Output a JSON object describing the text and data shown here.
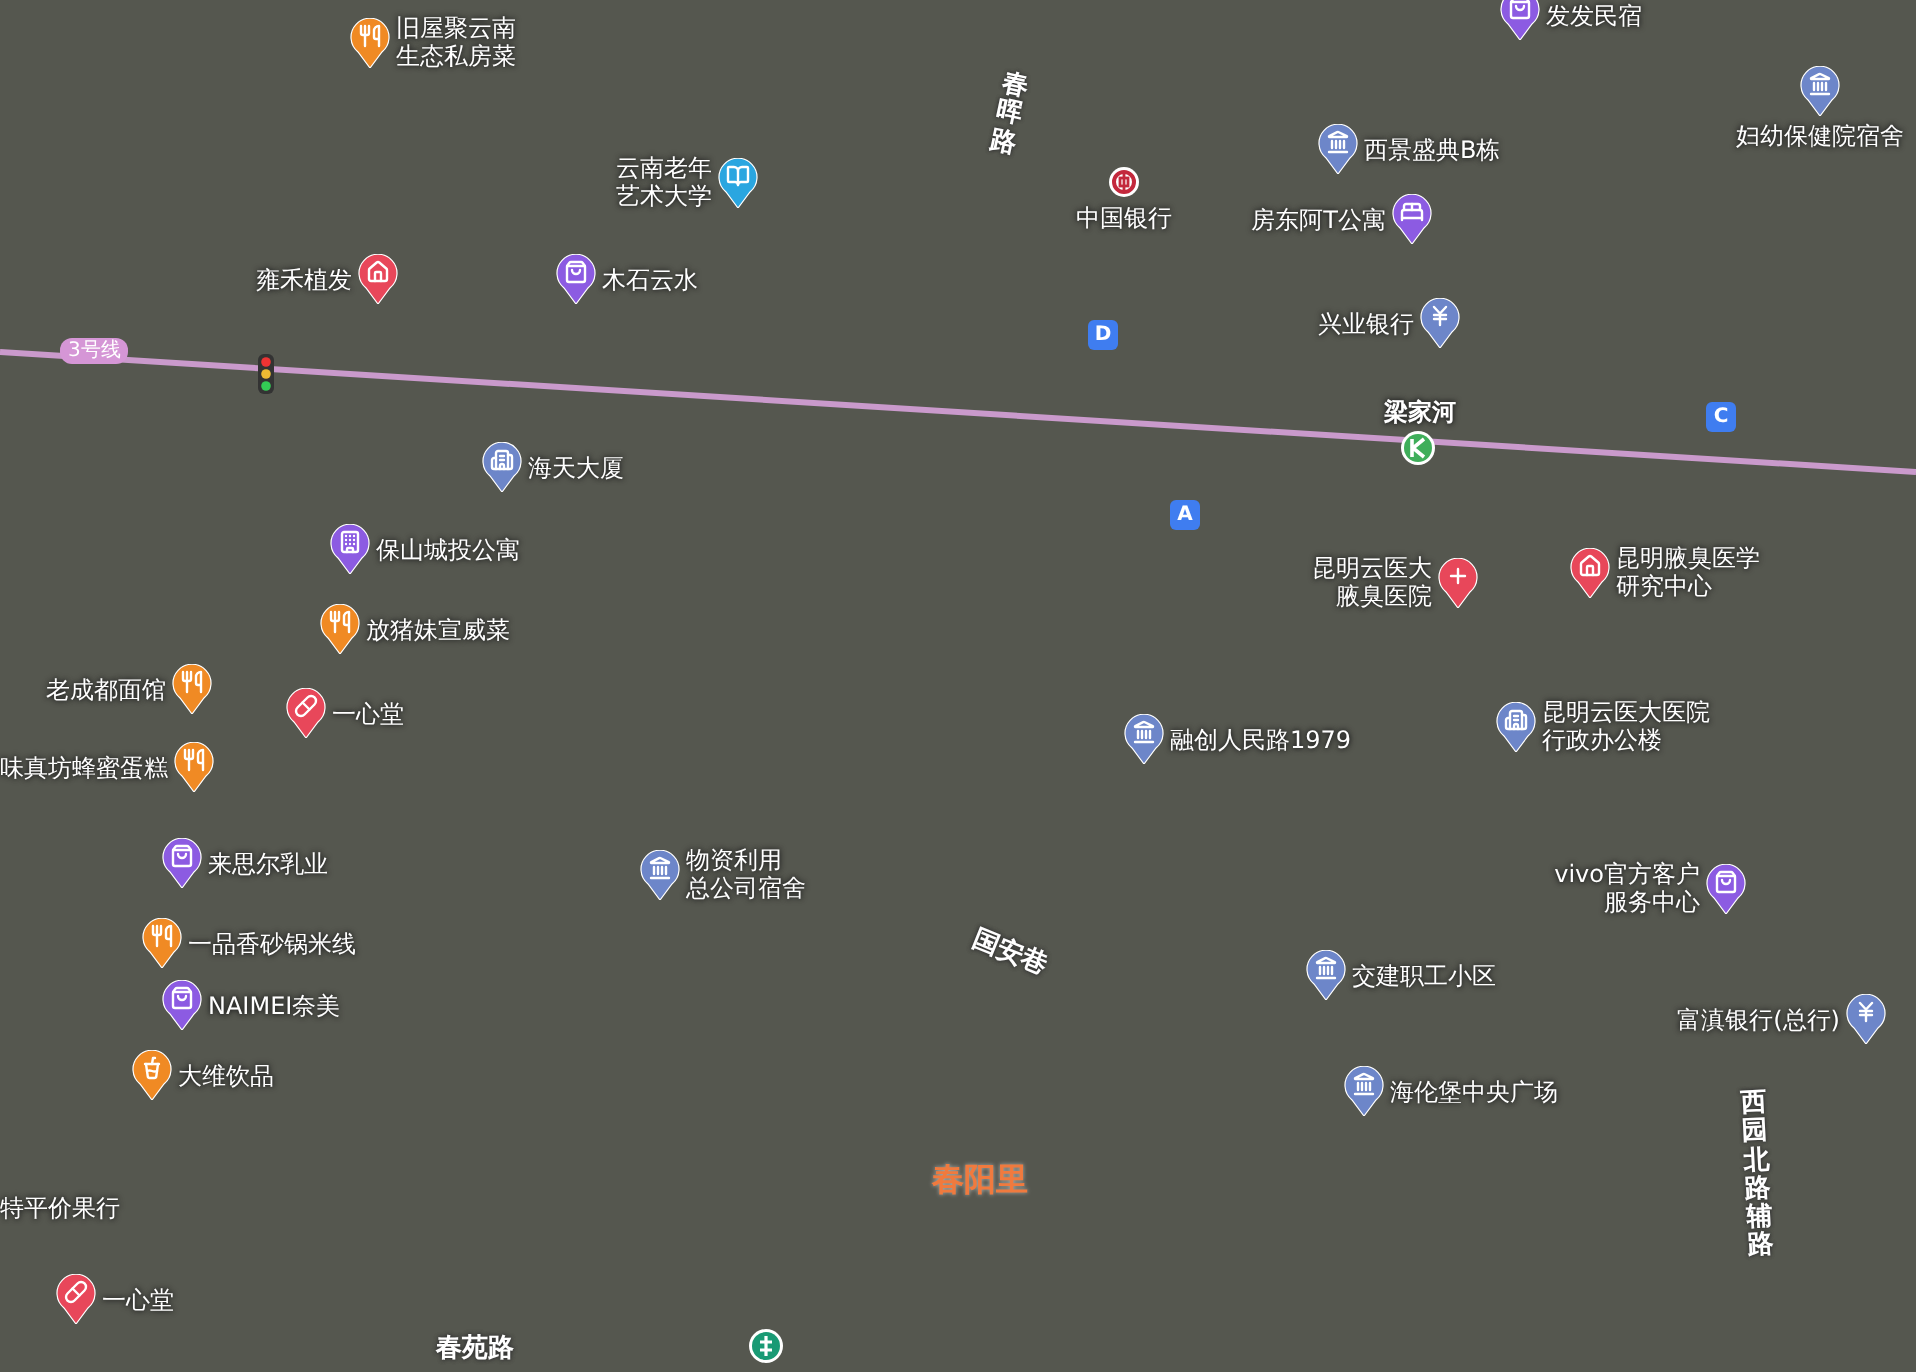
{
  "map": {
    "metro_line": {
      "label": "3号线"
    },
    "pois": [
      {
        "lines": [
          "旧屋聚云南",
          "生态私房菜"
        ],
        "kind": "food"
      },
      {
        "lines": [
          "发发民宿"
        ],
        "kind": "shop"
      },
      {
        "lines": [
          "云南老年",
          "艺术大学"
        ],
        "kind": "education"
      },
      {
        "lines": [
          "雍禾植发"
        ],
        "kind": "beauty"
      },
      {
        "lines": [
          "木石云水"
        ],
        "kind": "shop"
      },
      {
        "lines": [
          "西景盛典B栋"
        ],
        "kind": "residence"
      },
      {
        "lines": [
          "妇幼保健院宿舍"
        ],
        "kind": "residence"
      },
      {
        "lines": [
          "中国银行"
        ],
        "kind": "boc"
      },
      {
        "lines": [
          "房东阿T公寓"
        ],
        "kind": "hotel"
      },
      {
        "lines": [
          "兴业银行"
        ],
        "kind": "bank"
      },
      {
        "lines": [
          "海天大厦"
        ],
        "kind": "office"
      },
      {
        "lines": [
          "保山城投公寓"
        ],
        "kind": "apartment"
      },
      {
        "lines": [
          "放猪妹宣威菜"
        ],
        "kind": "food"
      },
      {
        "lines": [
          "老成都面馆"
        ],
        "kind": "food"
      },
      {
        "lines": [
          "一心堂"
        ],
        "kind": "pharmacy"
      },
      {
        "lines": [
          "味真坊蜂蜜蛋糕"
        ],
        "kind": "food"
      },
      {
        "lines": [
          "来思尔乳业"
        ],
        "kind": "shop"
      },
      {
        "lines": [
          "物资利用",
          "总公司宿舍"
        ],
        "kind": "residence"
      },
      {
        "lines": [
          "一品香砂锅米线"
        ],
        "kind": "food"
      },
      {
        "lines": [
          "NAIMEI奈美"
        ],
        "kind": "shop"
      },
      {
        "lines": [
          "大维饮品"
        ],
        "kind": "drink"
      },
      {
        "lines": [
          "特平价果行"
        ],
        "kind": "none"
      },
      {
        "lines": [
          "一心堂"
        ],
        "kind": "pharmacy"
      },
      {
        "lines": [
          "昆明云医大",
          "腋臭医院"
        ],
        "kind": "hospital"
      },
      {
        "lines": [
          "昆明腋臭医学",
          "研究中心"
        ],
        "kind": "beauty"
      },
      {
        "lines": [
          "融创人民路1979"
        ],
        "kind": "residence"
      },
      {
        "lines": [
          "昆明云医大医院",
          "行政办公楼"
        ],
        "kind": "office"
      },
      {
        "lines": [
          "vivo官方客户",
          "服务中心"
        ],
        "kind": "shop"
      },
      {
        "lines": [
          "交建职工小区"
        ],
        "kind": "residence"
      },
      {
        "lines": [
          "海伦堡中央广场"
        ],
        "kind": "residence"
      },
      {
        "lines": [
          "富滇银行(总行)"
        ],
        "kind": "bank"
      }
    ],
    "station": {
      "name": "梁家河"
    },
    "exits": [
      {
        "label": "D"
      },
      {
        "label": "C"
      },
      {
        "label": "A"
      }
    ],
    "roads": [
      {
        "name": "春晖路",
        "kind": "vertical"
      },
      {
        "name": "国安巷",
        "kind": "slanted"
      },
      {
        "name": "西园北路辅路",
        "kind": "vertical"
      },
      {
        "name": "春苑路",
        "kind": "horizontal"
      }
    ],
    "areas": [
      {
        "name": "春阳里"
      }
    ]
  }
}
